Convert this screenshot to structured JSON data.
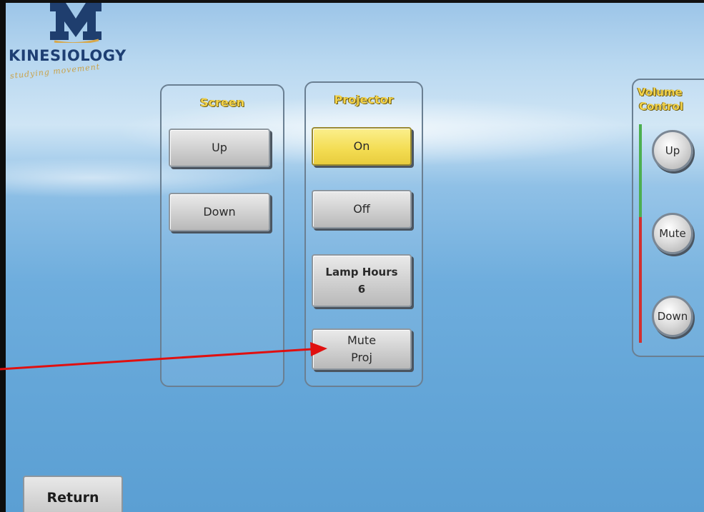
{
  "logo": {
    "text": "KINESIOLOGY",
    "tagline": "studying movement"
  },
  "screen_panel": {
    "title": "Screen",
    "up_label": "Up",
    "down_label": "Down"
  },
  "projector_panel": {
    "title": "Projector",
    "on_label": "On",
    "off_label": "Off",
    "lamp_hours_label": "Lamp Hours",
    "lamp_hours_value": "6",
    "mute_line1": "Mute",
    "mute_line2": "Proj",
    "on_active": true
  },
  "volume_panel": {
    "title_line1": "Volume",
    "title_line2": "Control",
    "up_label": "Up",
    "mute_label": "Mute",
    "down_label": "Down"
  },
  "return_label": "Return",
  "colors": {
    "title_yellow": "#f2d24a",
    "active_button": "#f3dc52",
    "annotation_arrow": "#e01010",
    "level_green": "#4caf50",
    "level_red": "#d32f2f"
  }
}
